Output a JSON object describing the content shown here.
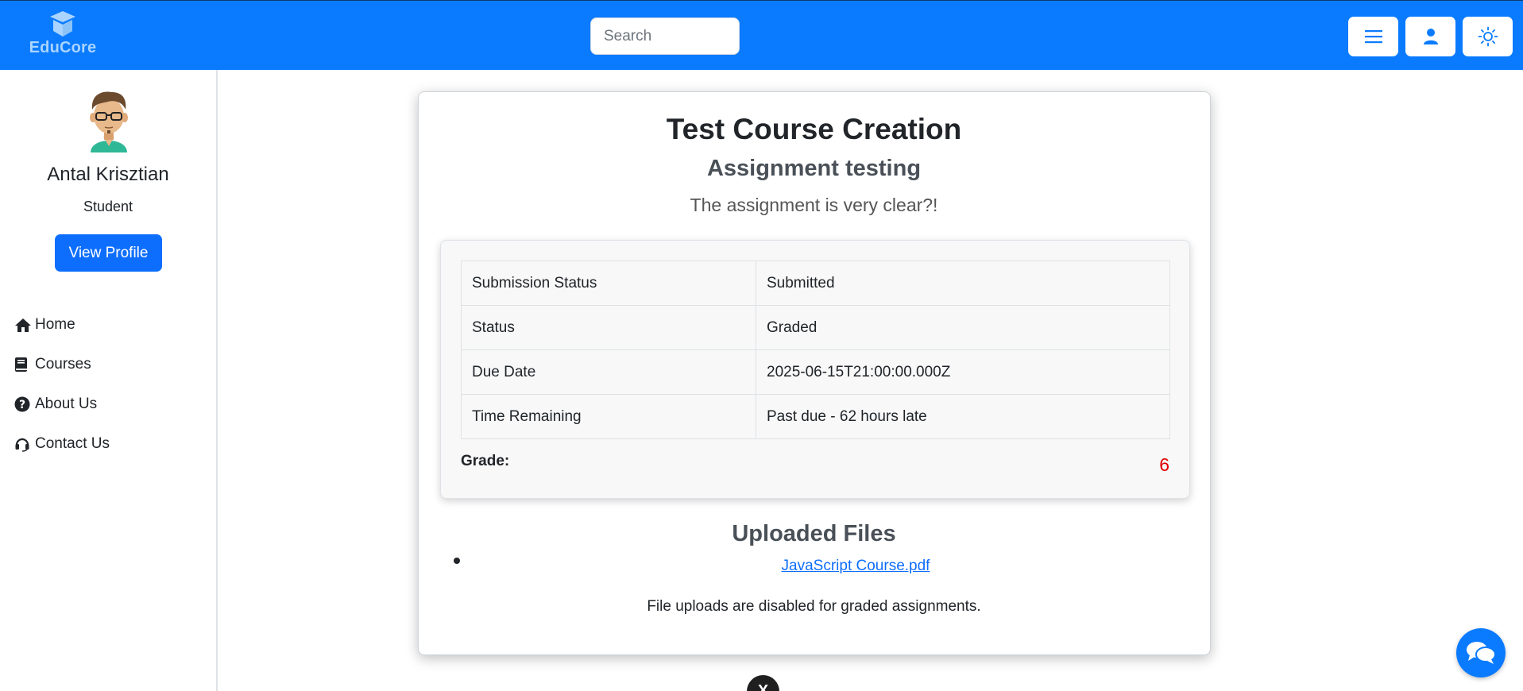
{
  "header": {
    "logo_text": "EduCore",
    "search_placeholder": "Search",
    "buttons": {
      "menu": "menu-icon",
      "profile": "user-icon",
      "theme": "sun-icon"
    },
    "accent_color": "#0a7bff"
  },
  "sidebar": {
    "user_name": "Antal Krisztian",
    "user_role": "Student",
    "view_profile_label": "View Profile",
    "nav": [
      {
        "label": "Home",
        "icon": "home-icon"
      },
      {
        "label": "Courses",
        "icon": "book-icon"
      },
      {
        "label": "About Us",
        "icon": "question-circle-icon"
      },
      {
        "label": "Contact Us",
        "icon": "headset-icon"
      }
    ]
  },
  "main": {
    "course_title": "Test Course Creation",
    "assignment_title": "Assignment testing",
    "assignment_description": "The assignment is very clear?!",
    "details": [
      {
        "label": "Submission Status",
        "value": "Submitted"
      },
      {
        "label": "Status",
        "value": "Graded"
      },
      {
        "label": "Due Date",
        "value": "2025-06-15T21:00:00.000Z"
      },
      {
        "label": "Time Remaining",
        "value": "Past due - 62 hours late"
      }
    ],
    "grade_label": "Grade:",
    "grade_value": "6",
    "grade_color": "#e00000",
    "uploaded_title": "Uploaded Files",
    "files": [
      {
        "name": "JavaScript Course.pdf"
      }
    ],
    "upload_note": "File uploads are disabled for graded assignments."
  },
  "overlay": {
    "close_label": "X",
    "chat_icon": "chat-icon"
  }
}
